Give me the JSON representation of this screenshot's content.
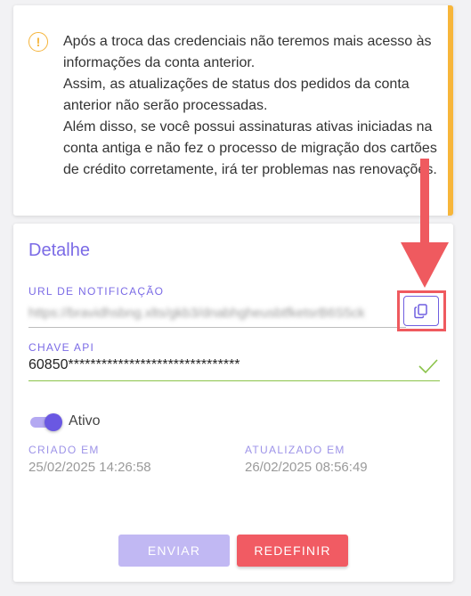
{
  "warning": {
    "icon": "exclamation-circle-icon",
    "accent_color": "#f7b63a",
    "line1": "Após a troca das credenciais não teremos mais acesso às informações da conta anterior.",
    "line2": "Assim, as atualizações de status dos pedidos da conta anterior não serão processadas.",
    "line3": "Além disso, se você possui assinaturas ativas iniciadas na conta antiga e não fez o processo de migração dos cartões de crédito corretamente, irá ter problemas nas renovações."
  },
  "detail": {
    "title": "Detalhe",
    "notification_url": {
      "label": "URL DE NOTIFICAÇÃO",
      "value": "https://bravidhsbng.xlts/gkb3/dnabhgheusbtfketsrB6S5ck"
    },
    "api_key": {
      "label": "CHAVE API",
      "value": "60850*******************************"
    },
    "active": {
      "label": "Ativo",
      "enabled": true
    },
    "created": {
      "label": "CRIADO EM",
      "value": "25/02/2025 14:26:58"
    },
    "updated": {
      "label": "ATUALIZADO EM",
      "value": "26/02/2025 08:56:49"
    },
    "buttons": {
      "send": "ENVIAR",
      "reset": "REDEFINIR"
    }
  },
  "colors": {
    "primary": "#7b6be6",
    "danger": "#f15b63",
    "success": "#8bc34a",
    "annotation": "#ef5a5f"
  }
}
